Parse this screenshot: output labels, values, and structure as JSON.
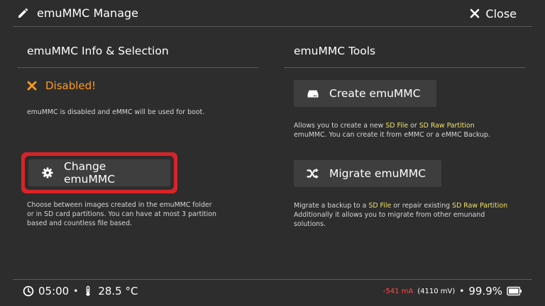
{
  "header": {
    "title": "emuMMC Manage",
    "close_label": "Close",
    "icons": {
      "title": "pencil-icon",
      "close": "close-icon"
    }
  },
  "left": {
    "section_title": "emuMMC Info & Selection",
    "status_text": "Disabled!",
    "status_icon": "cross-icon",
    "status_color": "#ff9a1f",
    "status_desc": "emuMMC is disabled and eMMC will be used for boot.",
    "change_button": "Change emuMMC",
    "change_icon": "gear-icon",
    "change_desc_lines": [
      "Choose between images created in the emuMMC folder",
      "or in SD card partitions. You can have at most 3 partition",
      "based and countless file based."
    ],
    "highlight_color": "#d7242a"
  },
  "right": {
    "section_title": "emuMMC Tools",
    "create_button": "Create emuMMC",
    "create_icon": "drive-icon",
    "create_desc": {
      "l1_a": "Allows you to create a new ",
      "sd_file": "SD File",
      "or": " or ",
      "sd_raw": "SD Raw Partition",
      "l2": "emuMMC. You can create it from eMMC or a eMMC Backup."
    },
    "migrate_button": "Migrate emuMMC",
    "migrate_icon": "shuffle-icon",
    "migrate_desc": {
      "l1_a": "Migrate a backup to a ",
      "sd_file": "SD File",
      "l1_b": " or repair existing ",
      "sd_raw": "SD Raw Partition",
      "l2": "Additionally it allows you to migrate from other emunand",
      "l3": "solutions."
    },
    "accent_text_color": "#f0e068"
  },
  "footer": {
    "time": "05:00",
    "temperature": "28.5 °C",
    "current": "-541 mA",
    "voltage": "(4110 mV)",
    "battery": "99.9%",
    "bullet": "•",
    "icons": {
      "time": "clock-icon",
      "temp": "thermometer-icon",
      "battery": "battery-icon"
    }
  }
}
